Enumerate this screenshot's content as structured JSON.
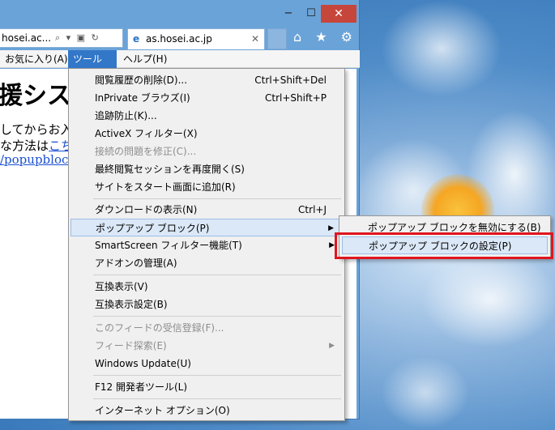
{
  "window": {
    "minimize": "−",
    "maximize": "☐",
    "close": "✕"
  },
  "address": {
    "text": "hosei.ac...",
    "icons": "⌕ ▾ ▣ ↻"
  },
  "tab": {
    "icon": "e",
    "title": "as.hosei.ac.jp",
    "close": "✕"
  },
  "toolbar_icons": "⌂ ★ ⚙",
  "menubar": {
    "favorites": "お気に入り(A)",
    "tools": "ツール(T)",
    "help": "ヘルプ(H)"
  },
  "page": {
    "heading": "援システ",
    "line1": "してからお入",
    "line2_prefix": "な方法は",
    "line2_link": "こちら",
    "line3_link": "/popupblock/"
  },
  "tools_menu": {
    "items": [
      {
        "label": "閲覧履歴の削除(D)...",
        "shortcut": "Ctrl+Shift+Del"
      },
      {
        "label": "InPrivate ブラウズ(I)",
        "shortcut": "Ctrl+Shift+P"
      },
      {
        "label": "追跡防止(K)..."
      },
      {
        "label": "ActiveX フィルター(X)"
      },
      {
        "label": "接続の問題を修正(C)..."
      },
      {
        "label": "最終閲覧セッションを再度開く(S)"
      },
      {
        "label": "サイトをスタート画面に追加(R)"
      },
      {
        "label": "ダウンロードの表示(N)",
        "shortcut": "Ctrl+J"
      },
      {
        "label": "ポップアップ ブロック(P)"
      },
      {
        "label": "SmartScreen フィルター機能(T)"
      },
      {
        "label": "アドオンの管理(A)"
      },
      {
        "label": "互換表示(V)"
      },
      {
        "label": "互換表示設定(B)"
      },
      {
        "label": "このフィードの受信登録(F)..."
      },
      {
        "label": "フィード探索(E)"
      },
      {
        "label": "Windows Update(U)"
      },
      {
        "label": "F12 開発者ツール(L)"
      },
      {
        "label": "インターネット オプション(O)"
      }
    ],
    "arrow": "▶"
  },
  "popup_submenu": {
    "items": [
      {
        "label": "ポップアップ ブロックを無効にする(B)"
      },
      {
        "label": "ポップアップ ブロックの設定(P)"
      }
    ]
  },
  "colors": {
    "highlight": "#e0151f",
    "menu_active": "#3277c8",
    "link": "#1a4fd1"
  }
}
